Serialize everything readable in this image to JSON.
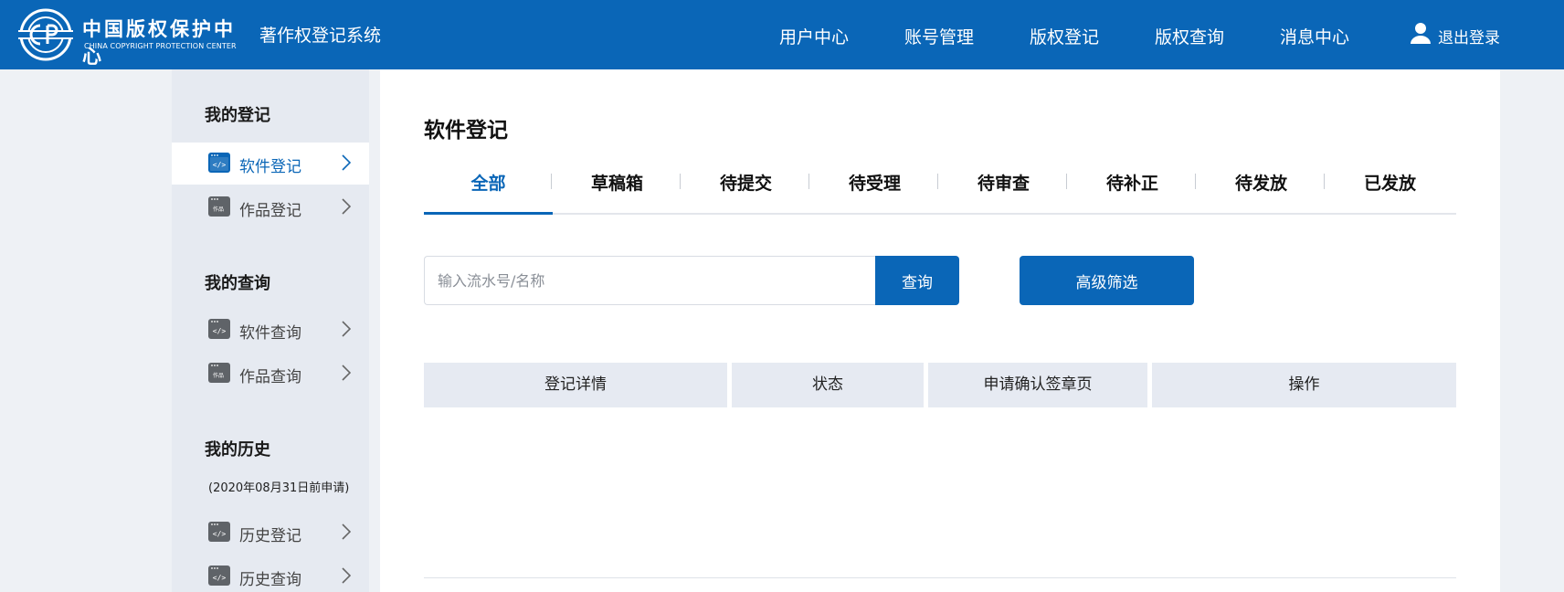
{
  "header": {
    "logo_cn": "中国版权保护中心",
    "logo_en": "CHINA COPYRIGHT PROTECTION CENTER",
    "system_name": "著作权登记系统",
    "nav": [
      "用户中心",
      "账号管理",
      "版权登记",
      "版权查询",
      "消息中心"
    ],
    "logout_label": "退出登录",
    "logout_icon": "user-icon",
    "brand_color": "#0a66b7"
  },
  "sidebar": {
    "sections": [
      {
        "heading": "我的登记",
        "items": [
          {
            "label": "软件登记",
            "icon": "software-code-icon",
            "active": true
          },
          {
            "label": "作品登记",
            "icon": "work-document-icon",
            "active": false
          }
        ]
      },
      {
        "heading": "我的查询",
        "items": [
          {
            "label": "软件查询",
            "icon": "software-code-icon",
            "active": false
          },
          {
            "label": "作品查询",
            "icon": "work-document-icon",
            "active": false
          }
        ]
      },
      {
        "heading": "我的历史",
        "subheading": "(2020年08月31日前申请)",
        "items": [
          {
            "label": "历史登记",
            "icon": "software-code-icon",
            "active": false
          },
          {
            "label": "历史查询",
            "icon": "software-code-icon",
            "active": false
          }
        ]
      }
    ]
  },
  "main": {
    "title": "软件登记",
    "tabs": [
      "全部",
      "草稿箱",
      "待提交",
      "待受理",
      "待审查",
      "待补正",
      "待发放",
      "已发放"
    ],
    "active_tab": "全部",
    "search": {
      "placeholder": "输入流水号/名称",
      "value": "",
      "button_label": "查询"
    },
    "filter_button_label": "高级筛选",
    "table": {
      "columns": [
        "登记详情",
        "状态",
        "申请确认签章页",
        "操作"
      ],
      "rows": []
    }
  }
}
